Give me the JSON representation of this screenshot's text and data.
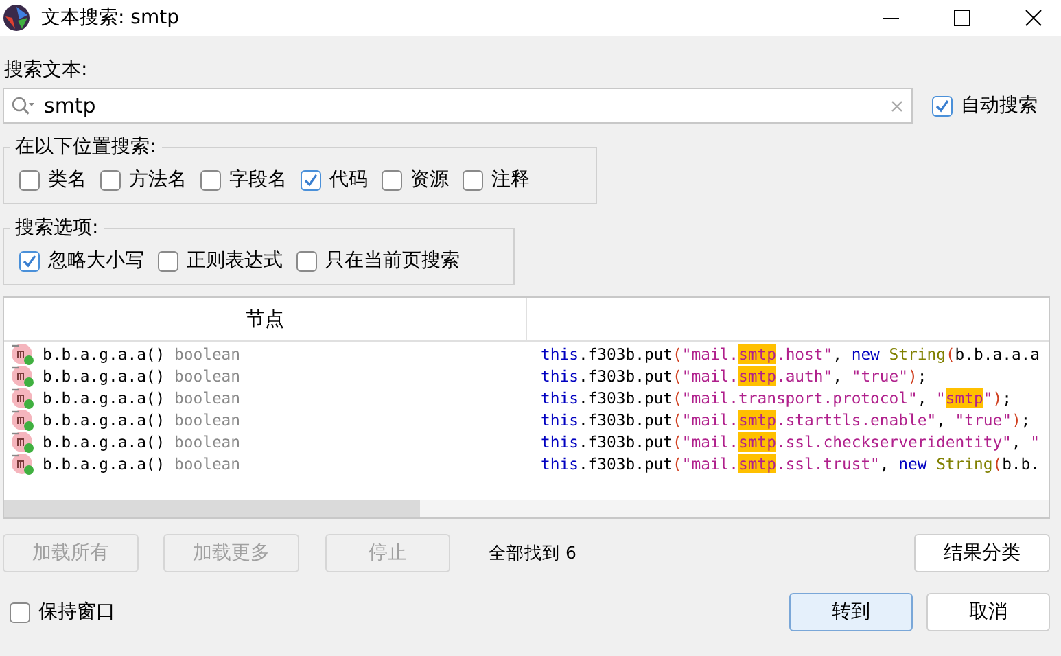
{
  "window": {
    "title": "文本搜索: smtp"
  },
  "search": {
    "label": "搜索文本:",
    "value": "smtp",
    "auto_search": {
      "label": "自动搜索",
      "checked": true
    }
  },
  "search_in": {
    "title": "在以下位置搜索:",
    "options": [
      {
        "label": "类名",
        "checked": false
      },
      {
        "label": "方法名",
        "checked": false
      },
      {
        "label": "字段名",
        "checked": false
      },
      {
        "label": "代码",
        "checked": true
      },
      {
        "label": "资源",
        "checked": false
      },
      {
        "label": "注释",
        "checked": false
      }
    ]
  },
  "search_options": {
    "title": "搜索选项:",
    "options": [
      {
        "label": "忽略大小写",
        "checked": true
      },
      {
        "label": "正则表达式",
        "checked": false
      },
      {
        "label": "只在当前页搜索",
        "checked": false
      }
    ]
  },
  "table": {
    "columns": [
      "节点"
    ],
    "rows": [
      {
        "node": "b.b.a.g.a.a()",
        "type": "boolean",
        "code": [
          {
            "kind": "keyword",
            "text": "this"
          },
          {
            "kind": "plain",
            "text": ".f303b.put"
          },
          {
            "kind": "paren",
            "text": "("
          },
          {
            "kind": "string",
            "text": "\"mail."
          },
          {
            "kind": "match",
            "text": "smtp"
          },
          {
            "kind": "string",
            "text": ".host\""
          },
          {
            "kind": "plain",
            "text": ", "
          },
          {
            "kind": "keyword",
            "text": "new "
          },
          {
            "kind": "type",
            "text": "String"
          },
          {
            "kind": "paren",
            "text": "("
          },
          {
            "kind": "plain",
            "text": "b.b.a.a.a"
          }
        ]
      },
      {
        "node": "b.b.a.g.a.a()",
        "type": "boolean",
        "code": [
          {
            "kind": "keyword",
            "text": "this"
          },
          {
            "kind": "plain",
            "text": ".f303b.put"
          },
          {
            "kind": "paren",
            "text": "("
          },
          {
            "kind": "string",
            "text": "\"mail."
          },
          {
            "kind": "match",
            "text": "smtp"
          },
          {
            "kind": "string",
            "text": ".auth\""
          },
          {
            "kind": "plain",
            "text": ", "
          },
          {
            "kind": "string",
            "text": "\"true\""
          },
          {
            "kind": "paren",
            "text": ")"
          },
          {
            "kind": "plain",
            "text": ";"
          }
        ]
      },
      {
        "node": "b.b.a.g.a.a()",
        "type": "boolean",
        "code": [
          {
            "kind": "keyword",
            "text": "this"
          },
          {
            "kind": "plain",
            "text": ".f303b.put"
          },
          {
            "kind": "paren",
            "text": "("
          },
          {
            "kind": "string",
            "text": "\"mail.transport.protocol\""
          },
          {
            "kind": "plain",
            "text": ", "
          },
          {
            "kind": "string",
            "text": "\""
          },
          {
            "kind": "match",
            "text": "smtp"
          },
          {
            "kind": "string",
            "text": "\""
          },
          {
            "kind": "paren",
            "text": ")"
          },
          {
            "kind": "plain",
            "text": ";"
          }
        ]
      },
      {
        "node": "b.b.a.g.a.a()",
        "type": "boolean",
        "code": [
          {
            "kind": "keyword",
            "text": "this"
          },
          {
            "kind": "plain",
            "text": ".f303b.put"
          },
          {
            "kind": "paren",
            "text": "("
          },
          {
            "kind": "string",
            "text": "\"mail."
          },
          {
            "kind": "match",
            "text": "smtp"
          },
          {
            "kind": "string",
            "text": ".starttls.enable\""
          },
          {
            "kind": "plain",
            "text": ", "
          },
          {
            "kind": "string",
            "text": "\"true\""
          },
          {
            "kind": "paren",
            "text": ")"
          },
          {
            "kind": "plain",
            "text": ";"
          }
        ]
      },
      {
        "node": "b.b.a.g.a.a()",
        "type": "boolean",
        "code": [
          {
            "kind": "keyword",
            "text": "this"
          },
          {
            "kind": "plain",
            "text": ".f303b.put"
          },
          {
            "kind": "paren",
            "text": "("
          },
          {
            "kind": "string",
            "text": "\"mail."
          },
          {
            "kind": "match",
            "text": "smtp"
          },
          {
            "kind": "string",
            "text": ".ssl.checkserveridentity\""
          },
          {
            "kind": "plain",
            "text": ", "
          },
          {
            "kind": "string",
            "text": "\""
          }
        ]
      },
      {
        "node": "b.b.a.g.a.a()",
        "type": "boolean",
        "code": [
          {
            "kind": "keyword",
            "text": "this"
          },
          {
            "kind": "plain",
            "text": ".f303b.put"
          },
          {
            "kind": "paren",
            "text": "("
          },
          {
            "kind": "string",
            "text": "\"mail."
          },
          {
            "kind": "match",
            "text": "smtp"
          },
          {
            "kind": "string",
            "text": ".ssl.trust\""
          },
          {
            "kind": "plain",
            "text": ", "
          },
          {
            "kind": "keyword",
            "text": "new "
          },
          {
            "kind": "type",
            "text": "String"
          },
          {
            "kind": "paren",
            "text": "("
          },
          {
            "kind": "plain",
            "text": "b.b."
          }
        ]
      }
    ]
  },
  "actions": [
    {
      "label": "加载所有",
      "disabled": true
    },
    {
      "label": "加载更多",
      "disabled": true
    },
    {
      "label": "停止",
      "disabled": true
    }
  ],
  "result_count": "全部找到  6",
  "group_button": {
    "label": "结果分类",
    "disabled": false
  },
  "keep_window": {
    "label": "保持窗口",
    "checked": false
  },
  "footer_buttons": [
    {
      "label": "转到",
      "default": true
    },
    {
      "label": "取消",
      "default": false
    }
  ]
}
